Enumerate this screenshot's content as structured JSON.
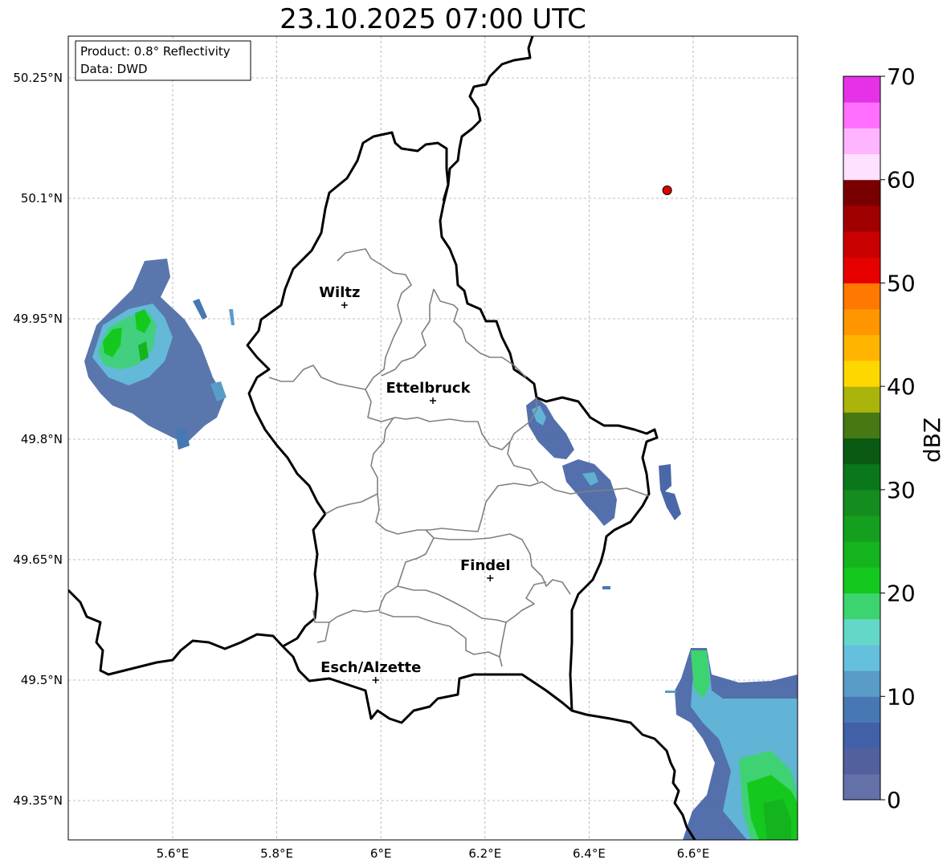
{
  "title": "23.10.2025 07:00 UTC",
  "info_box": {
    "product": "Product: 0.8° Reflectivity",
    "source": "Data: DWD"
  },
  "axes": {
    "x_ticks": [
      "5.6°E",
      "5.8°E",
      "6°E",
      "6.2°E",
      "6.4°E",
      "6.6°E"
    ],
    "y_ticks": [
      "50.25°N",
      "50.1°N",
      "49.95°N",
      "49.8°N",
      "49.65°N",
      "49.5°N",
      "49.35°N"
    ]
  },
  "cities": [
    {
      "name": "Wiltz",
      "lon": 5.93,
      "lat": 49.967
    },
    {
      "name": "Ettelbruck",
      "lon": 6.1,
      "lat": 49.848
    },
    {
      "name": "Findel",
      "lon": 6.21,
      "lat": 49.627
    },
    {
      "name": "Esch/Alzette",
      "lon": 5.99,
      "lat": 49.5
    }
  ],
  "marker": {
    "lon": 6.55,
    "lat": 50.11,
    "color": "#e00000"
  },
  "colorbar": {
    "label": "dBZ",
    "ticks": [
      "0",
      "10",
      "20",
      "30",
      "40",
      "50",
      "60",
      "70"
    ],
    "colors": [
      "#6470a8",
      "#52609e",
      "#4260a8",
      "#4878b4",
      "#5a9cc8",
      "#64c0dc",
      "#64d8c8",
      "#3cd46e",
      "#14c81e",
      "#14b41e",
      "#14a01e",
      "#148c1e",
      "#0a781a",
      "#0a5a14",
      "#467814",
      "#aab40a",
      "#ffd700",
      "#ffb400",
      "#ff9600",
      "#ff7800",
      "#e60000",
      "#c80000",
      "#a00000",
      "#780000",
      "#ffe1ff",
      "#ffb4ff",
      "#ff6eff",
      "#e632e6"
    ]
  }
}
